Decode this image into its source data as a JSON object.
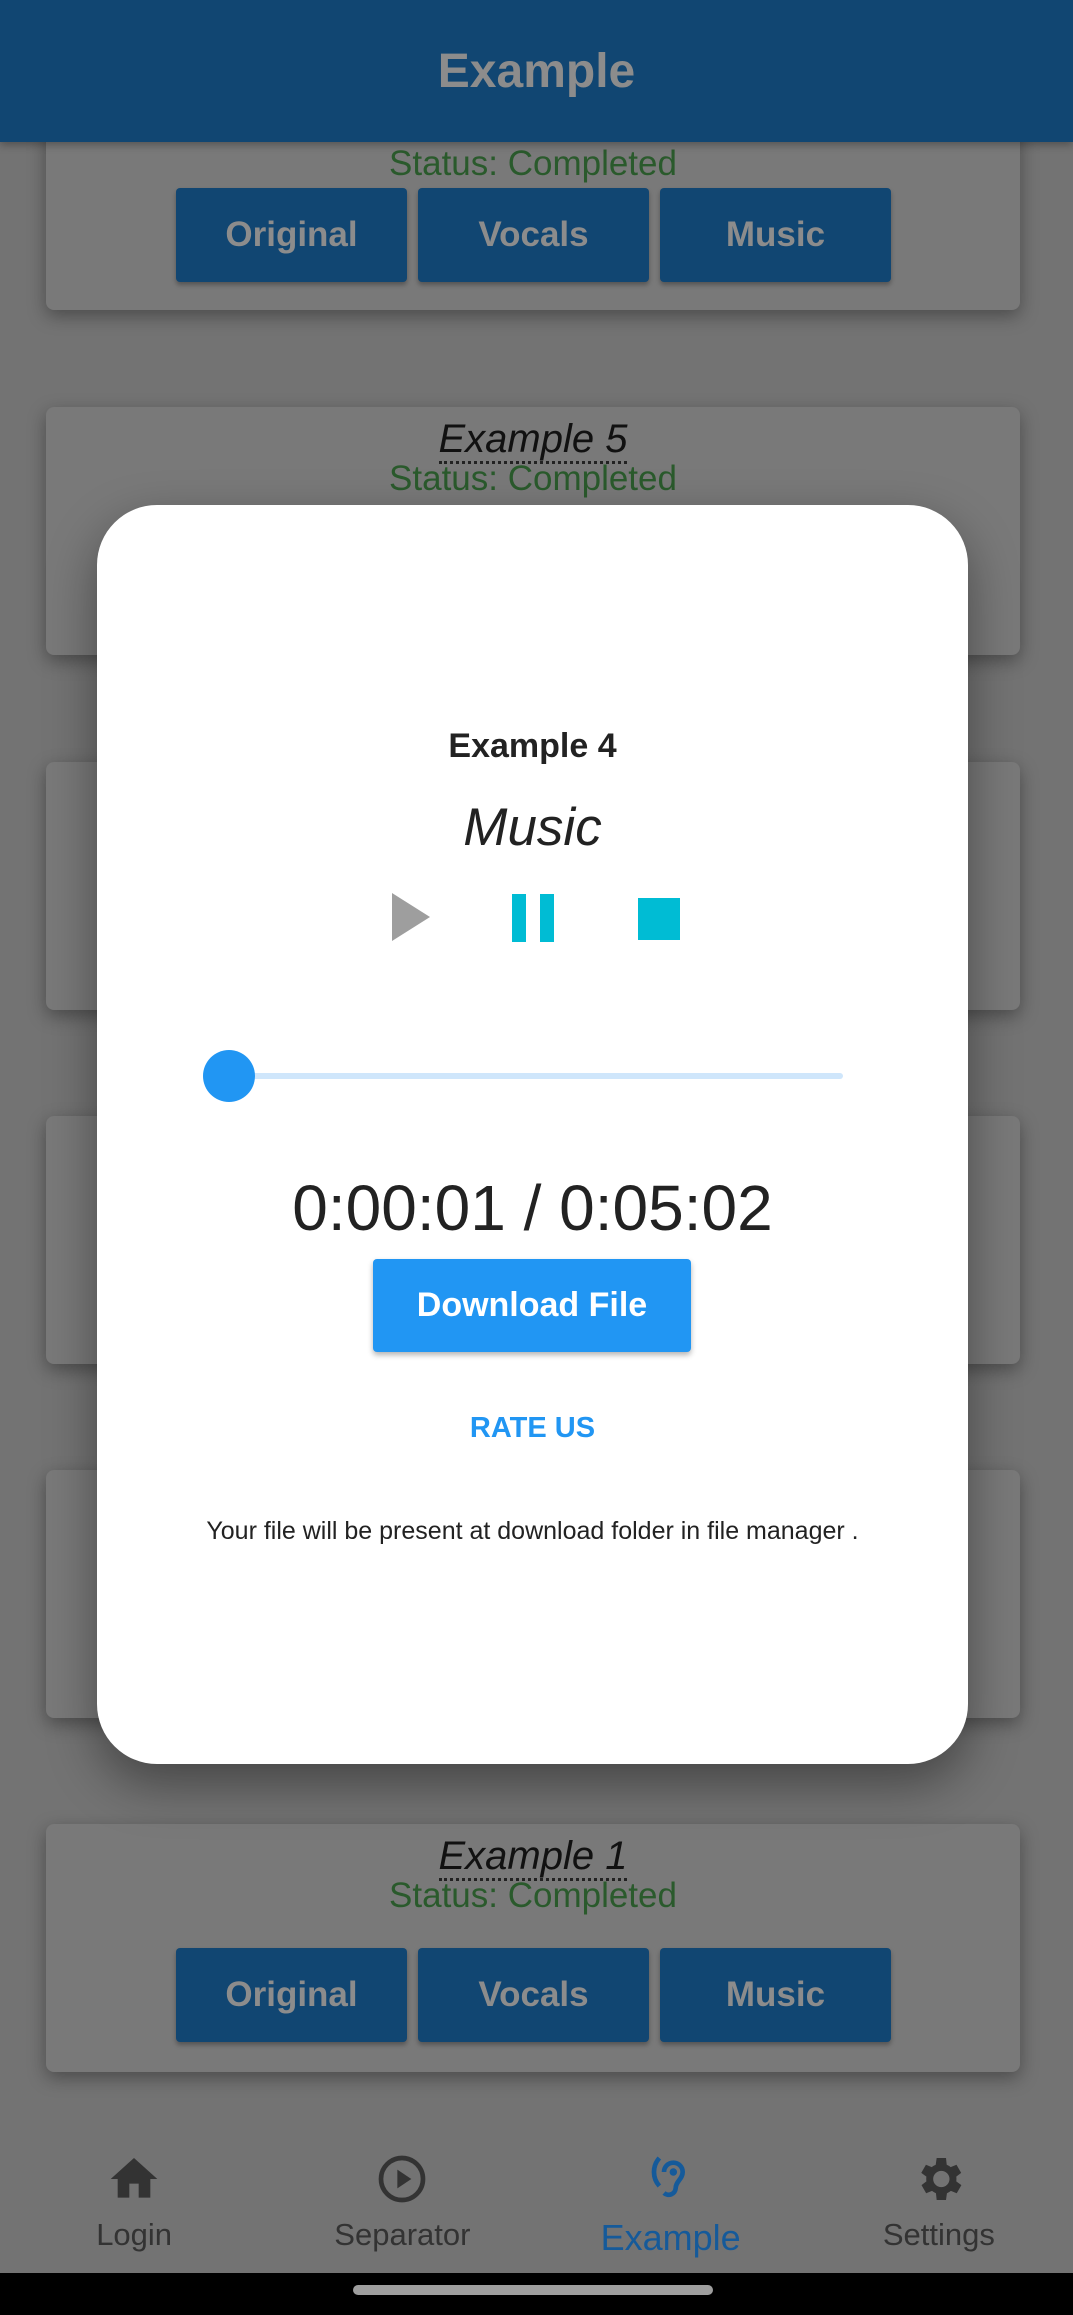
{
  "app_bar": {
    "title": "Example"
  },
  "cards": [
    {
      "status": "Status: Completed",
      "buttons": [
        "Original",
        "Vocals",
        "Music"
      ]
    },
    {
      "title": "Example 5",
      "status": "Status: Completed"
    },
    {
      "title": "Example 1",
      "status": "Status: Completed",
      "buttons": [
        "Original",
        "Vocals",
        "Music"
      ]
    }
  ],
  "dialog": {
    "title": "Example 4",
    "track_type": "Music",
    "controls": [
      "play-icon",
      "pause-icon",
      "stop-icon"
    ],
    "progress_fraction": 0.003,
    "time": "0:00:01 / 0:05:02",
    "download_label": "Download File",
    "rate_label": "RATE US",
    "note": "Your file will be present at download folder in file manager ."
  },
  "bottom_nav": [
    {
      "label": "Login",
      "icon": "home-icon"
    },
    {
      "label": "Separator",
      "icon": "play-circle-icon"
    },
    {
      "label": "Example",
      "icon": "hearing-icon",
      "active": true
    },
    {
      "label": "Settings",
      "icon": "gear-icon"
    }
  ],
  "colors": {
    "primary": "#2196F3",
    "status": "#2E7D32",
    "accent": "#00BCD4"
  }
}
